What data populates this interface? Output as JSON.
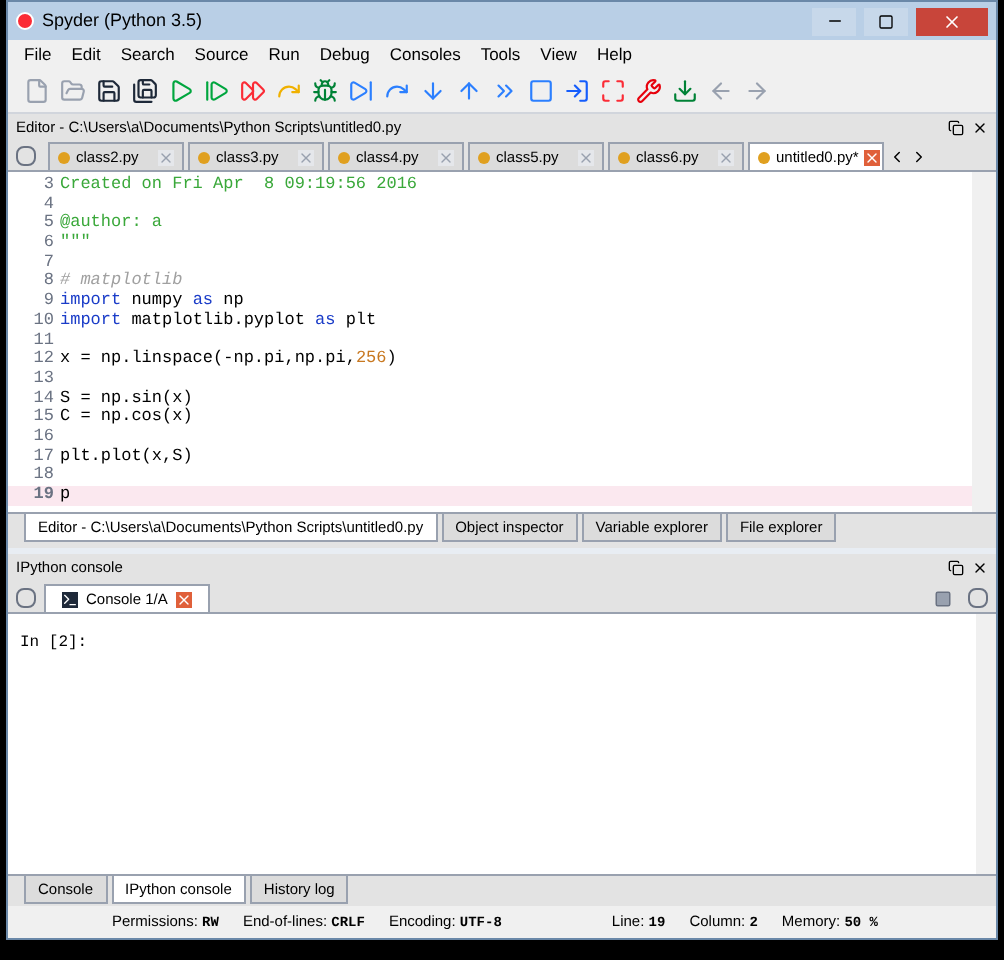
{
  "window": {
    "title": "Spyder (Python 3.5)"
  },
  "menu": [
    "File",
    "Edit",
    "Search",
    "Source",
    "Run",
    "Debug",
    "Consoles",
    "Tools",
    "View",
    "Help"
  ],
  "editor": {
    "title": "Editor - C:\\Users\\a\\Documents\\Python Scripts\\untitled0.py",
    "tabs": [
      {
        "label": "class2.py",
        "selected": false
      },
      {
        "label": "class3.py",
        "selected": false
      },
      {
        "label": "class4.py",
        "selected": false
      },
      {
        "label": "class5.py",
        "selected": false
      },
      {
        "label": "class6.py",
        "selected": false
      },
      {
        "label": "untitled0.py*",
        "selected": true
      }
    ],
    "lines": [
      {
        "number": "3",
        "current": false,
        "segments": [
          {
            "text": "Created on Fri Apr  8 09:19:56 2016",
            "kind": "string"
          }
        ]
      },
      {
        "number": "4",
        "current": false
      },
      {
        "number": "5",
        "current": false,
        "segments": [
          {
            "text": "@author: a",
            "kind": "string"
          }
        ]
      },
      {
        "number": "6",
        "current": false,
        "segments": [
          {
            "text": "\"\"\"",
            "kind": "string"
          }
        ]
      },
      {
        "number": "7",
        "current": false
      },
      {
        "number": "8",
        "current": false,
        "segments": [
          {
            "text": "# matplotlib",
            "kind": "comment"
          }
        ]
      },
      {
        "number": "9",
        "current": false,
        "segments": [
          {
            "text": "import",
            "kind": "keyword"
          },
          {
            "text": " numpy ",
            "kind": "plain"
          },
          {
            "text": "as",
            "kind": "keyword"
          },
          {
            "text": " np",
            "kind": "plain"
          }
        ]
      },
      {
        "number": "10",
        "current": false,
        "segments": [
          {
            "text": "import",
            "kind": "keyword"
          },
          {
            "text": " matplotlib.pyplot ",
            "kind": "plain"
          },
          {
            "text": "as",
            "kind": "keyword"
          },
          {
            "text": " plt",
            "kind": "plain"
          }
        ]
      },
      {
        "number": "11",
        "current": false
      },
      {
        "number": "12",
        "current": false,
        "segments": [
          {
            "text": "x = np.linspace(-np.pi,np.pi,",
            "kind": "plain"
          },
          {
            "text": "256",
            "kind": "number"
          },
          {
            "text": ")",
            "kind": "plain"
          }
        ]
      },
      {
        "number": "13",
        "current": false
      },
      {
        "number": "14",
        "current": false,
        "segments": [
          {
            "text": "S = np.sin(x)",
            "kind": "plain"
          }
        ]
      },
      {
        "number": "15",
        "current": false,
        "segments": [
          {
            "text": "C = np.cos(x)",
            "kind": "plain"
          }
        ]
      },
      {
        "number": "16",
        "current": false
      },
      {
        "number": "17",
        "current": false,
        "segments": [
          {
            "text": "plt.plot(x,S)",
            "kind": "plain"
          }
        ]
      },
      {
        "number": "18",
        "current": false
      },
      {
        "number": "19",
        "current": true,
        "segments": [
          {
            "text": "p",
            "kind": "plain"
          }
        ]
      }
    ]
  },
  "upper_tabs": [
    {
      "label": "Editor - C:\\Users\\a\\Documents\\Python Scripts\\untitled0.py",
      "selected": true
    },
    {
      "label": "Object inspector",
      "selected": false
    },
    {
      "label": "Variable explorer",
      "selected": false
    },
    {
      "label": "File explorer",
      "selected": false
    }
  ],
  "console": {
    "title": "IPython console",
    "tab": "Console 1/A",
    "prompt": "In [2]:"
  },
  "lower_tabs": [
    {
      "label": "Console",
      "selected": false
    },
    {
      "label": "IPython console",
      "selected": true
    },
    {
      "label": "History log",
      "selected": false
    }
  ],
  "status_bar": [
    {
      "label": "Permissions:",
      "value": "RW"
    },
    {
      "label": "End-of-lines:",
      "value": "CRLF"
    },
    {
      "label": "Encoding:",
      "value": "UTF-8"
    },
    {
      "label": "Line:",
      "value": "19"
    },
    {
      "label": "Column:",
      "value": "2"
    },
    {
      "label": "Memory:",
      "value": "50 %"
    }
  ]
}
